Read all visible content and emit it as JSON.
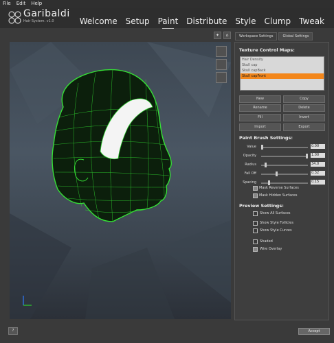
{
  "menu": [
    "File",
    "Edit",
    "Help"
  ],
  "logo": {
    "name": "Garibaldi",
    "sub": "Hair System.  v1.0"
  },
  "nav": [
    "Welcome",
    "Setup",
    "Paint",
    "Distribute",
    "Style",
    "Clump",
    "Tweak"
  ],
  "active_nav": "Paint",
  "tabs": [
    "Workspace Settings",
    "Global Settings"
  ],
  "texture_maps": {
    "title": "Texture Control Maps:",
    "items": [
      "Hair Density",
      "Skull cap",
      "Skull capBack",
      "Skull capFront"
    ],
    "selected": "Skull capFront"
  },
  "map_buttons": [
    "New",
    "Copy",
    "Rename",
    "Delete",
    "Fill",
    "Invert",
    "Import",
    "Export"
  ],
  "paint_brush": {
    "title": "Paint Brush Settings:",
    "sliders": [
      {
        "label": "Value",
        "value": "0.00",
        "level": 0.0
      },
      {
        "label": "Opacity",
        "value": "1.00",
        "level": 1.0
      },
      {
        "label": "Radius",
        "value": "34.0",
        "level": 0.08
      },
      {
        "label": "Fall Off",
        "value": "0.32",
        "level": 0.32
      },
      {
        "label": "Spacing",
        "value": "0.15",
        "level": 0.15
      }
    ],
    "checks": [
      {
        "label": "Mask Reverse Surfaces",
        "checked": true
      },
      {
        "label": "Mask Hidden Surfaces",
        "checked": true
      }
    ]
  },
  "preview": {
    "title": "Preview Settings:",
    "checks": [
      {
        "label": "Show All Surfaces",
        "checked": false
      },
      {
        "label": "Show Style Follicles",
        "checked": false
      },
      {
        "label": "Show Style Curves",
        "checked": false
      },
      {
        "label": "Shaded",
        "checked": false
      },
      {
        "label": "Wire Overlay",
        "checked": true
      }
    ]
  },
  "footer": {
    "help": "?",
    "accept": "Accept"
  },
  "colors": {
    "accent": "#f3861a",
    "wire": "#2fd02f"
  }
}
